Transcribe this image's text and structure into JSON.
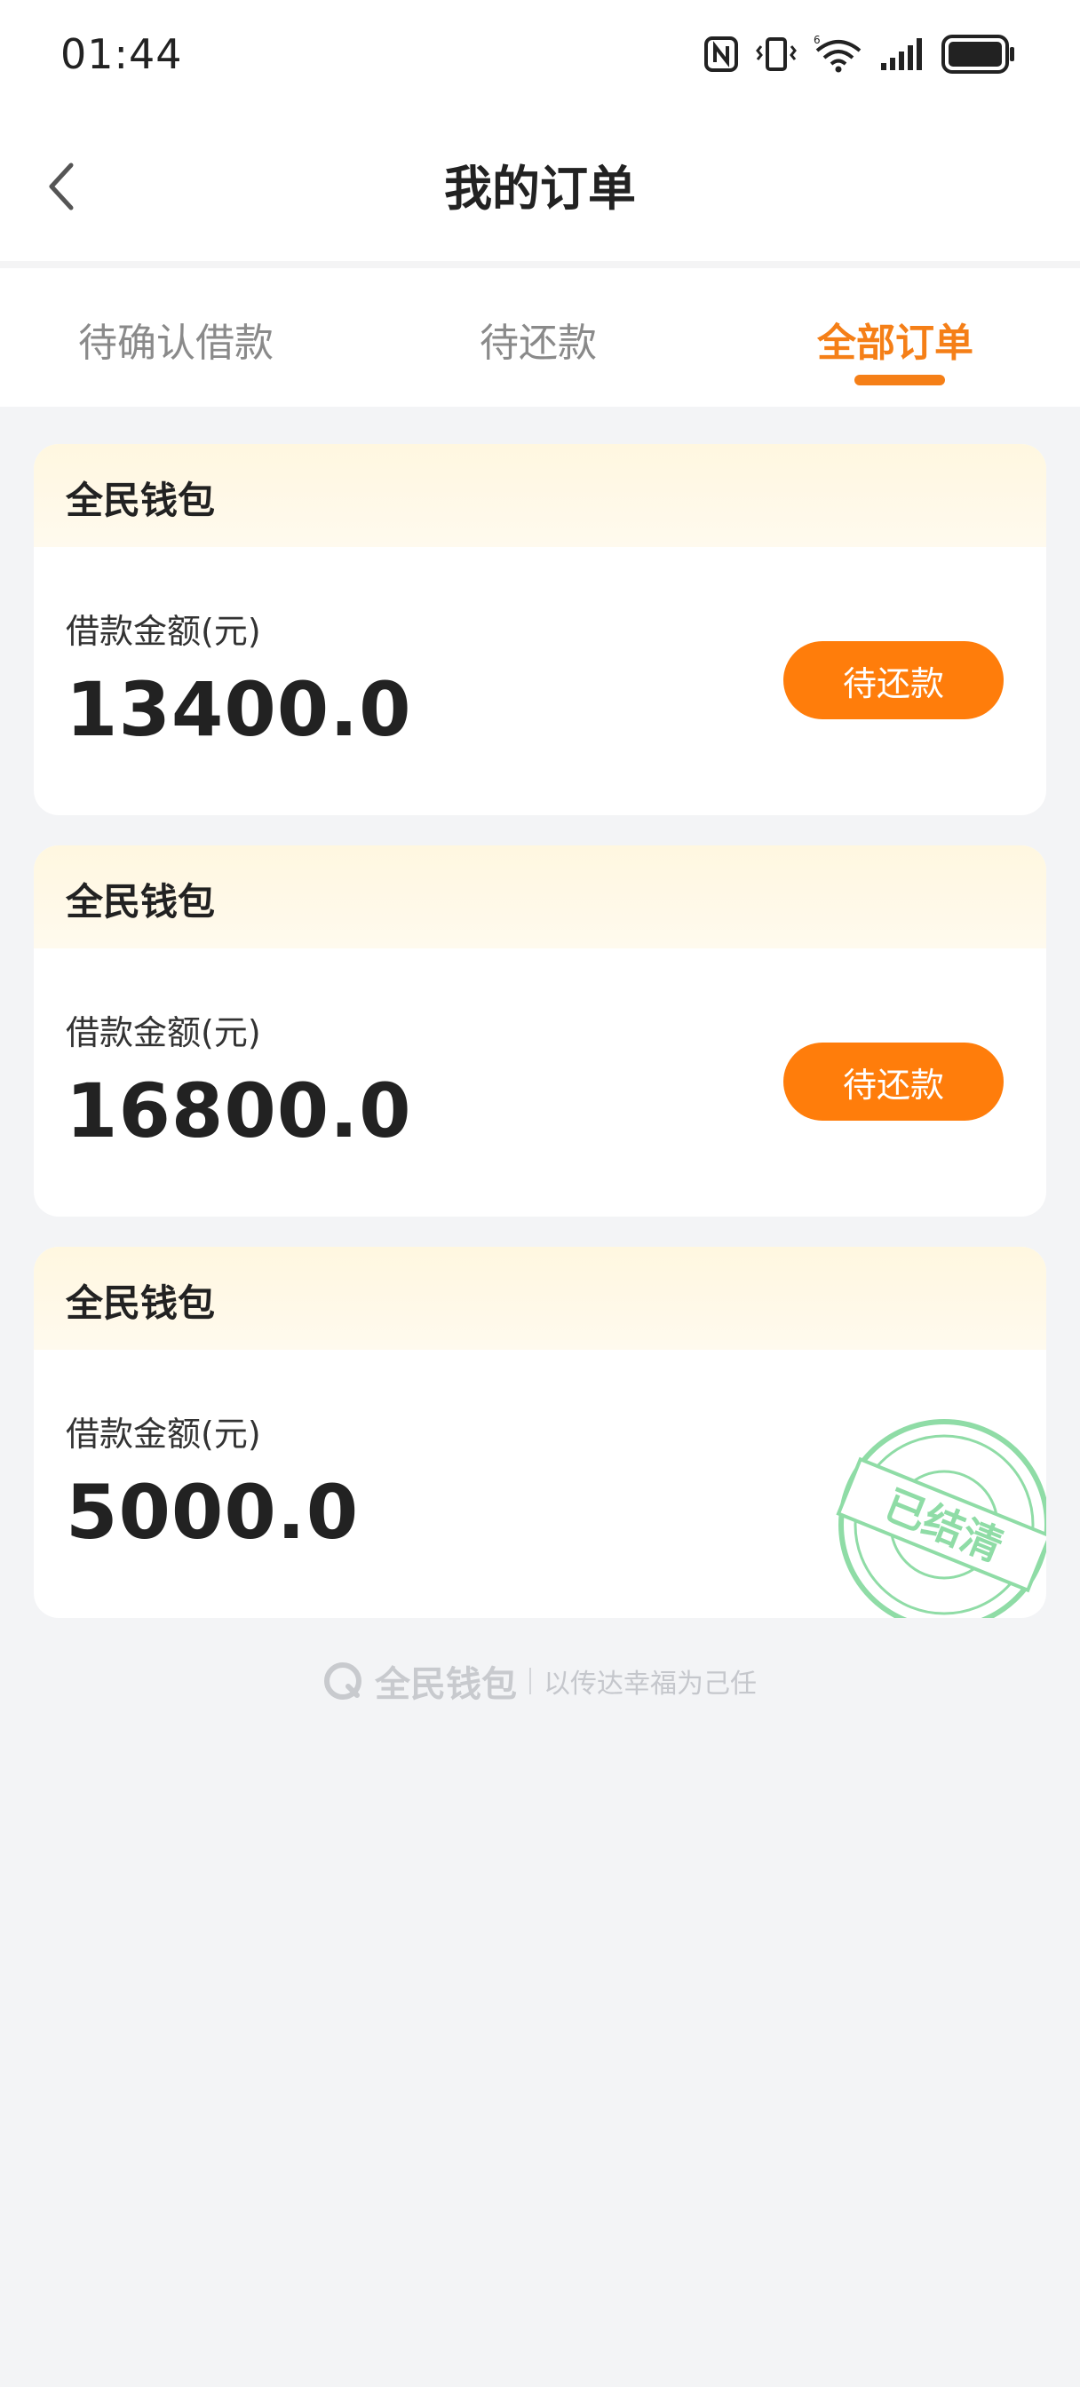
{
  "status_bar": {
    "time": "01:44"
  },
  "nav": {
    "title": "我的订单"
  },
  "tabs": [
    {
      "label": "待确认借款",
      "active": false
    },
    {
      "label": "待还款",
      "active": false
    },
    {
      "label": "全部订单",
      "active": true
    }
  ],
  "orders": [
    {
      "brand": "全民钱包",
      "amount_label": "借款金额(元)",
      "amount": "13400.0",
      "status": "待还款"
    },
    {
      "brand": "全民钱包",
      "amount_label": "借款金额(元)",
      "amount": "16800.0",
      "status": "待还款"
    },
    {
      "brand": "全民钱包",
      "amount_label": "借款金额(元)",
      "amount": "5000.0",
      "stamp": "已结清"
    }
  ],
  "footer": {
    "logo_text": "全民钱包",
    "slogan": "以传达幸福为己任"
  },
  "colors": {
    "accent": "#f57f17",
    "button": "#ff7d0b",
    "stamp": "#8fdca6"
  }
}
